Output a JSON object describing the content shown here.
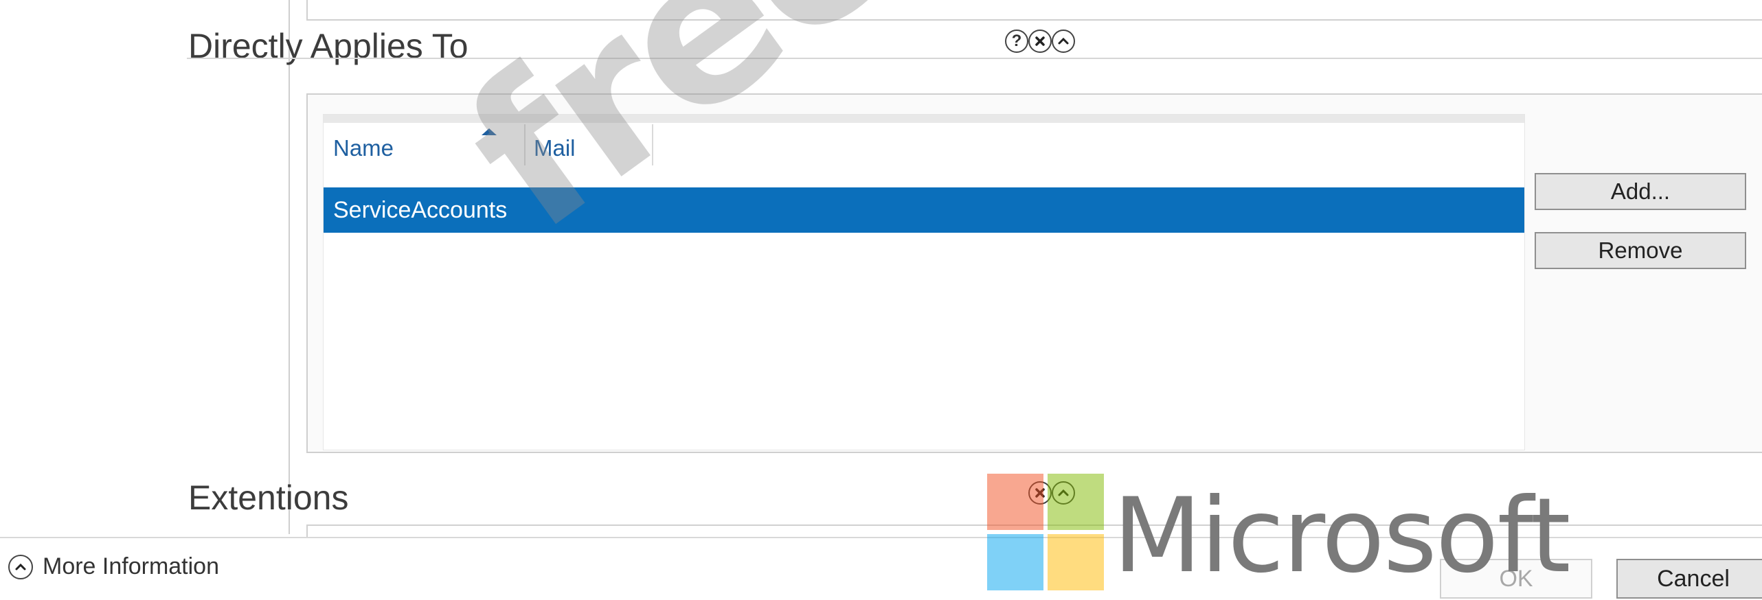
{
  "sections": {
    "directly_applies_to": {
      "title": "Directly Applies To"
    },
    "extensions": {
      "title": "Extentions"
    }
  },
  "grid": {
    "columns": [
      {
        "label": "Name",
        "sorted": "ascending"
      },
      {
        "label": "Mail"
      }
    ],
    "rows": [
      {
        "name": "ServiceAccounts",
        "mail": "",
        "selected": true
      }
    ]
  },
  "actions": {
    "add": "Add...",
    "remove": "Remove"
  },
  "footer": {
    "more_information": "More Information",
    "ok": "OK",
    "cancel": "Cancel",
    "ok_enabled": false
  },
  "icons": {
    "help": "?",
    "close": "×",
    "collapse": "^"
  },
  "watermarks": {
    "diagonal_text": "free",
    "brand_text": "Microsoft",
    "brand_colors": [
      "#f25022",
      "#7fba00",
      "#00a4ef",
      "#ffb900"
    ]
  },
  "colors": {
    "selection": "#0b6fbb",
    "column_header": "#1e5fa0"
  }
}
